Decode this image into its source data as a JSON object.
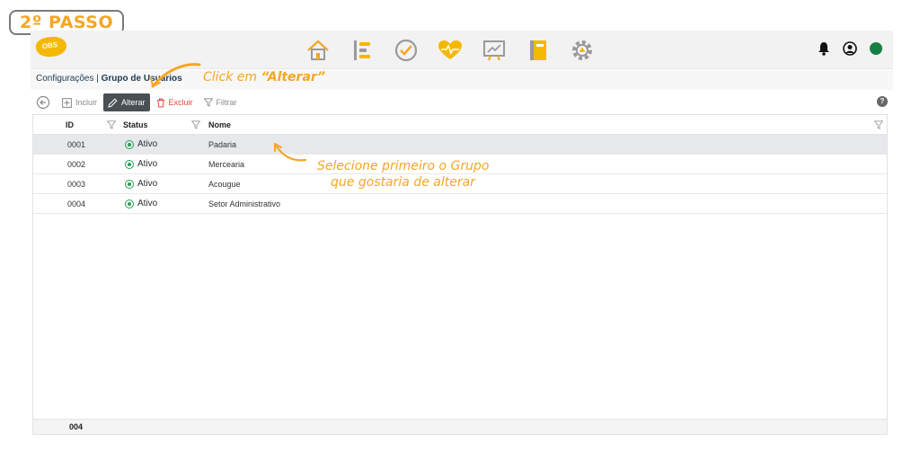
{
  "step_badge": "2º PASSO",
  "header": {
    "logo_text": "OBS",
    "nav_icons": [
      "home-icon",
      "list-icon",
      "check-circle-icon",
      "heart-pulse-icon",
      "chart-board-icon",
      "notebook-icon",
      "settings-network-icon"
    ],
    "right_icons": [
      "bell-icon",
      "user-icon",
      "status-dot"
    ],
    "status_color": "#168043"
  },
  "breadcrumb": {
    "section": "Configurações",
    "separator": " | ",
    "page": "Grupo de Usuários"
  },
  "toolbar": {
    "include_label": "Incluir",
    "edit_label": "Alterar",
    "delete_label": "Excluir",
    "filter_label": "Filtrar",
    "help": "?"
  },
  "table": {
    "columns": [
      "ID",
      "Status",
      "Nome"
    ],
    "rows": [
      {
        "id": "0001",
        "status": "Ativo",
        "name": "Padaria"
      },
      {
        "id": "0002",
        "status": "Ativo",
        "name": "Mercearia"
      },
      {
        "id": "0003",
        "status": "Ativo",
        "name": "Acougue"
      },
      {
        "id": "0004",
        "status": "Ativo",
        "name": "Setor Administrativo"
      }
    ],
    "footer_count": "004"
  },
  "annotations": {
    "click_prefix": "Click em ",
    "click_target": "“Alterar”",
    "select_line1": "Selecione primeiro o Grupo",
    "select_line2": "que gostaria de alterar"
  },
  "colors": {
    "accent": "#f5a623",
    "selected_row": "#e6e9ec",
    "active_button": "#4a4f54",
    "danger": "#e5463c",
    "status_green": "#2a9d55"
  }
}
